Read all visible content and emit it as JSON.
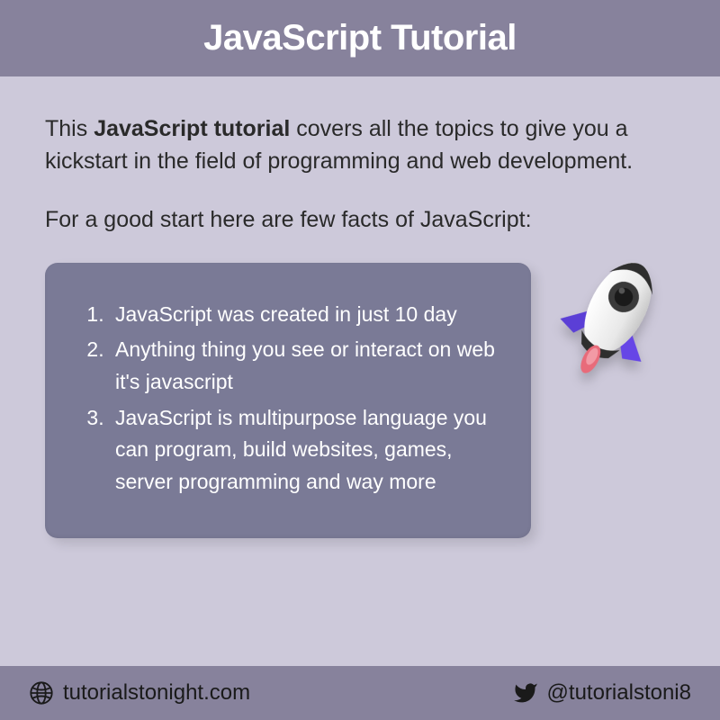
{
  "header": {
    "title": "JavaScript Tutorial"
  },
  "content": {
    "intro_pre": "This ",
    "intro_bold": "JavaScript tutorial",
    "intro_post": " covers all the topics to give you a kickstart in the field of programming and web development.",
    "subintro": "For a good start here are few facts of JavaScript:",
    "facts": [
      "JavaScript was created in just 10 day",
      "Anything thing you see or interact on web it's javascript",
      "JavaScript is multipurpose language you can program, build websites, games, server programming and way more"
    ]
  },
  "footer": {
    "website": "tutorialstonight.com",
    "twitter_handle": "@tutorialstoni8"
  }
}
